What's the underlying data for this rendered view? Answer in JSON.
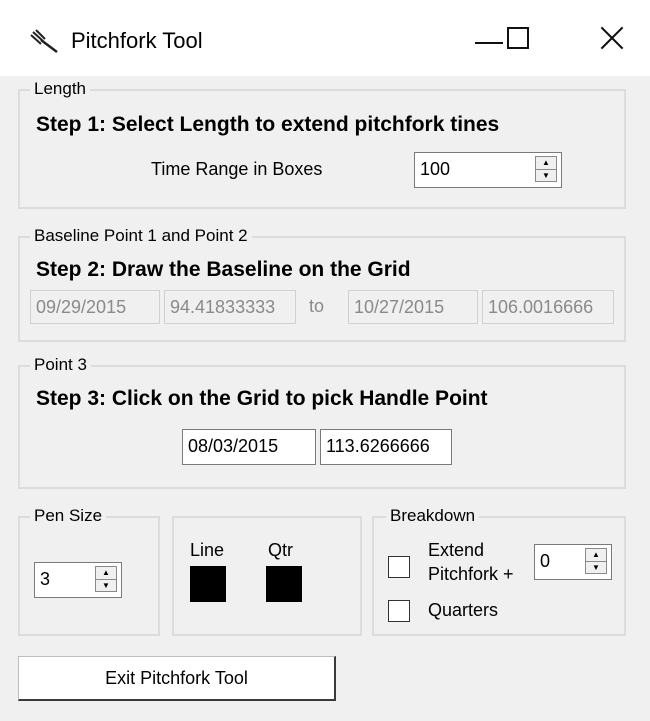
{
  "window": {
    "title": "Pitchfork Tool",
    "icon": "pitchfork-icon",
    "controls": [
      "minimize-icon",
      "maximize-icon",
      "close-icon"
    ]
  },
  "length": {
    "legend": "Length",
    "step": "Step 1: Select Length to extend pitchfork tines",
    "time_range_label": "Time Range in Boxes",
    "time_range_value": "100"
  },
  "baseline": {
    "legend": "Baseline Point 1 and Point 2",
    "step": "Step 2: Draw the Baseline on the Grid",
    "point1_date": "09/29/2015",
    "point1_value": "94.41833333",
    "to_label": "to",
    "point2_date": "10/27/2015",
    "point2_value": "106.0016666"
  },
  "point3": {
    "legend": "Point 3",
    "step": "Step 3: Click on the Grid to pick Handle Point",
    "date": "08/03/2015",
    "value": "113.6266666"
  },
  "pen": {
    "legend": "Pen Size",
    "value": "3"
  },
  "colors": {
    "line_label": "Line",
    "qtr_label": "Qtr",
    "line_color": "#000000",
    "qtr_color": "#000000"
  },
  "breakdown": {
    "legend": "Breakdown",
    "extend_label_1": "Extend",
    "extend_label_2": "Pitchfork +",
    "extend_value": "0",
    "quarters_label": "Quarters"
  },
  "exit_button": "Exit Pitchfork Tool"
}
